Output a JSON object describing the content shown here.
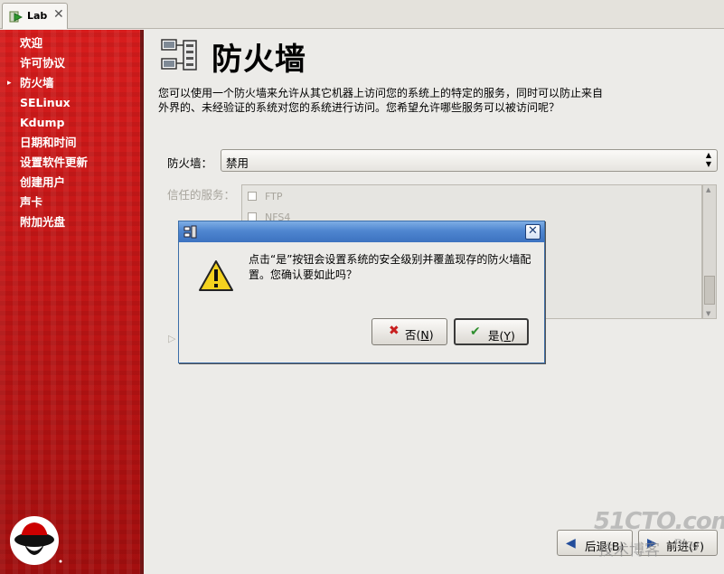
{
  "tab": {
    "label": "Lab",
    "close": "✕"
  },
  "sidebar": {
    "items": [
      {
        "label": "欢迎",
        "active": false
      },
      {
        "label": "许可协议",
        "active": false
      },
      {
        "label": "防火墙",
        "active": true
      },
      {
        "label": "SELinux",
        "active": false
      },
      {
        "label": "Kdump",
        "active": false
      },
      {
        "label": "日期和时间",
        "active": false
      },
      {
        "label": "设置软件更新",
        "active": false
      },
      {
        "label": "创建用户",
        "active": false
      },
      {
        "label": "声卡",
        "active": false
      },
      {
        "label": "附加光盘",
        "active": false
      }
    ],
    "active_marker": "▸",
    "logo_icon": "redhat-shadowman-icon"
  },
  "main": {
    "title": "防火墙",
    "title_icon": "firewall-icon",
    "description": "您可以使用一个防火墙来允许从其它机器上访问您的系统上的特定的服务，同时可以防止来自外界的、未经验证的系统对您的系统进行访问。您希望允许哪些服务可以被访问呢？",
    "firewall_label": "防火墙：",
    "firewall_value": "禁用",
    "trusted_label": "信任的服务：",
    "services": [
      {
        "name": "FTP",
        "checked": false
      },
      {
        "name": "NFS4",
        "checked": false
      }
    ],
    "back_label": "后退(B)",
    "next_label": "前进(F)"
  },
  "dialog": {
    "title_icon": "dialog-app-icon",
    "close": "✕",
    "warning_icon": "warning-icon",
    "message": "点击“是”按钮会设置系统的安全级别并覆盖现存的防火墙配置。您确认要如此吗？",
    "no_label": "否",
    "no_mnemonic": "N",
    "yes_label": "是",
    "yes_mnemonic": "Y"
  },
  "watermark": {
    "site": "51CTO.com",
    "sub": "技术博客",
    "blog": "Blog"
  },
  "colors": {
    "sidebar_red": "#c21616",
    "titlebar_blue": "#4f86d0",
    "background": "#ecebe8"
  }
}
